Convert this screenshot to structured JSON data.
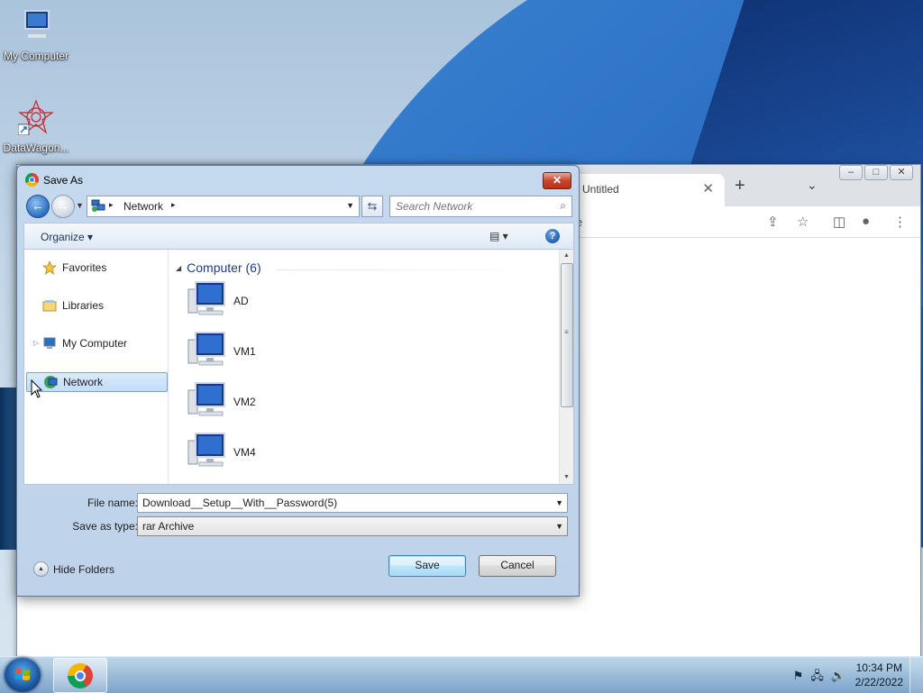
{
  "desktop": {
    "icons": [
      {
        "label": "My Computer",
        "icon": "my-computer-icon"
      },
      {
        "label": "DataWagon...",
        "icon": "datawagon-shortcut-icon"
      }
    ]
  },
  "browser": {
    "tab_title": "Untitled",
    "tab_close": "✕",
    "new_tab": "+",
    "tab_dropdown": "⌄",
    "omnibox_tail": "e",
    "window_buttons": [
      "‒",
      "□",
      "✕"
    ],
    "toolbar_icons": [
      "share-icon",
      "star-icon",
      "sidepanel-icon",
      "profile-icon",
      "menu-icon"
    ]
  },
  "dialog": {
    "title": "Save As",
    "close_label": "✕",
    "address": {
      "crumb": "Network",
      "arrow": "▸"
    },
    "search_placeholder": "Search Network",
    "organize_label": "Organize ▾",
    "views_label": "▤ ▾",
    "help_label": "?",
    "nav": [
      {
        "label": "Favorites",
        "icon": "star-icon"
      },
      {
        "label": "Libraries",
        "icon": "libraries-icon"
      },
      {
        "label": "My Computer",
        "icon": "computer-icon"
      },
      {
        "label": "Network",
        "icon": "network-icon",
        "selected": true
      }
    ],
    "group_header": "Computer (6)",
    "computers": [
      "AD",
      "VM1",
      "VM2",
      "VM4"
    ],
    "file_name_label": "File name:",
    "file_name_value": "Download__Setup__With__Password(5)",
    "save_type_label": "Save as type:",
    "save_type_value": "rar Archive",
    "hide_folders_label": "Hide Folders",
    "save_button": "Save",
    "cancel_button": "Cancel"
  },
  "taskbar": {
    "time": "10:34 PM",
    "date": "2/22/2022",
    "tray_icons": [
      "action-center-alert-icon",
      "network-tray-icon",
      "volume-icon"
    ]
  },
  "colors": {
    "dialog_frame": "#c4d8ee",
    "selection": "#c1dcfc",
    "close_red": "#c7452c",
    "group_header": "#1e3d7b"
  }
}
